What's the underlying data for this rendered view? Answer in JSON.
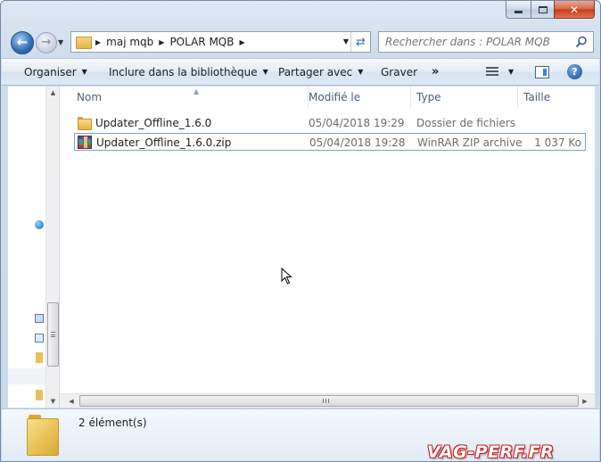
{
  "address": {
    "crumbs": [
      "maj mqb",
      "POLAR MQB"
    ]
  },
  "search": {
    "placeholder": "Rechercher dans : POLAR MQB"
  },
  "toolbar": {
    "organize": "Organiser",
    "include": "Inclure dans la bibliothèque",
    "share": "Partager avec",
    "burn": "Graver",
    "more": "»"
  },
  "columns": {
    "name": "Nom",
    "modified": "Modifié le",
    "type": "Type",
    "size": "Taille"
  },
  "files": [
    {
      "name": "Updater_Offline_1.6.0",
      "modified": "05/04/2018 19:29",
      "type": "Dossier de fichiers",
      "size": "",
      "icon": "folder-icon"
    },
    {
      "name": "Updater_Offline_1.6.0.zip",
      "modified": "05/04/2018 19:28",
      "type": "WinRAR ZIP archive",
      "size": "1 037 Ko",
      "icon": "winrar-zip-icon"
    }
  ],
  "details": {
    "count": "2 élément(s)"
  },
  "watermark": "VAG-PERF.FR",
  "colors": {
    "accent": "#2f6cb6",
    "selection_border": "#7da2ce",
    "watermark_red": "#d11c1c"
  }
}
